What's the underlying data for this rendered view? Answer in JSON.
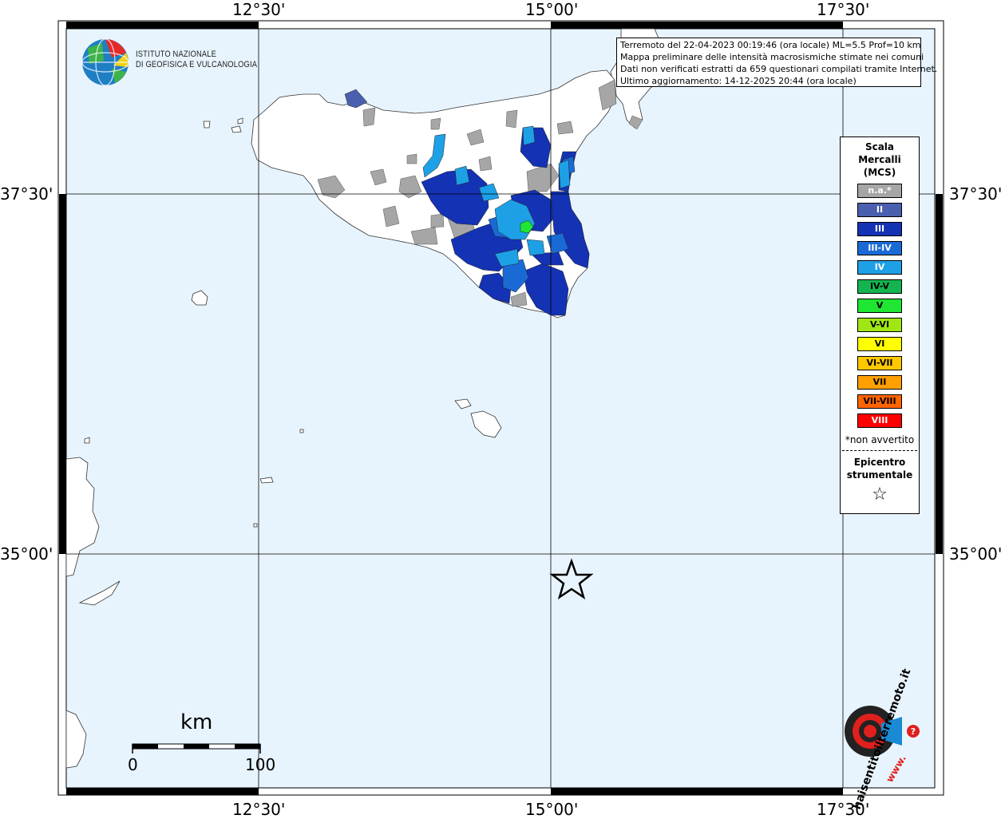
{
  "map": {
    "longitude_labels": [
      "12°30'",
      "15°00'",
      "17°30'"
    ],
    "latitude_labels": [
      "37°30'",
      "35°00'"
    ],
    "sea_color": "#e8f4fd",
    "land_color": "#ffffff"
  },
  "info": {
    "line1": "Terremoto del 22-04-2023 00:19:46 (ora locale) ML=5.5 Prof=10 km",
    "line2": "Mappa preliminare delle intensità macrosismiche stimate nei comuni",
    "line3": "Dati non verificati estratti da 659 questionari compilati tramite Internet.",
    "line4": "Ultimo aggiornamento: 14-12-2025 20:44 (ora locale)"
  },
  "logo": {
    "line1": "ISTITUTO NAZIONALE",
    "line2": "DI GEOFISICA E VULCANOLOGIA"
  },
  "legend": {
    "title1": "Scala",
    "title2": "Mercalli",
    "title3": "(MCS)",
    "items": [
      {
        "label": "n.a.*",
        "color": "#a6a6a6",
        "text": "#ffffff"
      },
      {
        "label": "II",
        "color": "#4a5fae",
        "text": "#ffffff"
      },
      {
        "label": "III",
        "color": "#1432b4",
        "text": "#ffffff"
      },
      {
        "label": "III-IV",
        "color": "#1a6ad6",
        "text": "#ffffff"
      },
      {
        "label": "IV",
        "color": "#1ea0e6",
        "text": "#ffffff"
      },
      {
        "label": "IV-V",
        "color": "#14b450",
        "text": "#000000"
      },
      {
        "label": "V",
        "color": "#1ee632",
        "text": "#000000"
      },
      {
        "label": "V-VI",
        "color": "#a0e614",
        "text": "#000000"
      },
      {
        "label": "VI",
        "color": "#ffff00",
        "text": "#000000"
      },
      {
        "label": "VI-VII",
        "color": "#ffc800",
        "text": "#000000"
      },
      {
        "label": "VII",
        "color": "#ffa000",
        "text": "#000000"
      },
      {
        "label": "VII-VIII",
        "color": "#ff6400",
        "text": "#000000"
      },
      {
        "label": "VIII",
        "color": "#ff0000",
        "text": "#ffffff"
      }
    ],
    "note": "*non avvertito",
    "epicenter1": "Epicentro",
    "epicenter2": "strumentale",
    "epicenter_symbol": "☆"
  },
  "scale_bar": {
    "unit": "km",
    "start": "0",
    "end": "100"
  },
  "badge": {
    "text": "haisentitoilterremoto.it",
    "prefix": "www."
  }
}
